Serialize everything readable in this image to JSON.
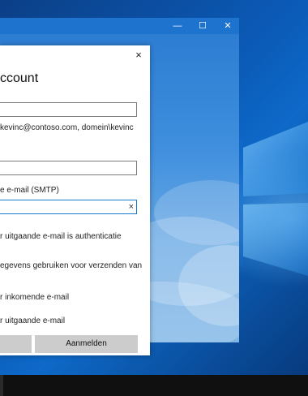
{
  "window_controls": {
    "minimize_glyph": "—",
    "maximize_glyph": "☐",
    "close_glyph": "✕"
  },
  "dialog": {
    "close_glyph": "×",
    "title": "ccount",
    "hint_username": "kevinc@contoso.com, domein\\kevinc",
    "label_smtp": "e e-mail (SMTP)",
    "smtp_clear_glyph": "×",
    "opt_outgoing_auth": "r uitgaande e-mail is authenticatie",
    "opt_same_credentials": "egevens gebruiken voor verzenden van",
    "opt_incoming_ssl": "r inkomende e-mail",
    "opt_outgoing_ssl": "r uitgaande e-mail",
    "cancel_label": "",
    "signin_label": "Aanmelden"
  },
  "colors": {
    "accent": "#1979ca",
    "titlebar": "#1e73cf",
    "taskbar": "#101010"
  }
}
